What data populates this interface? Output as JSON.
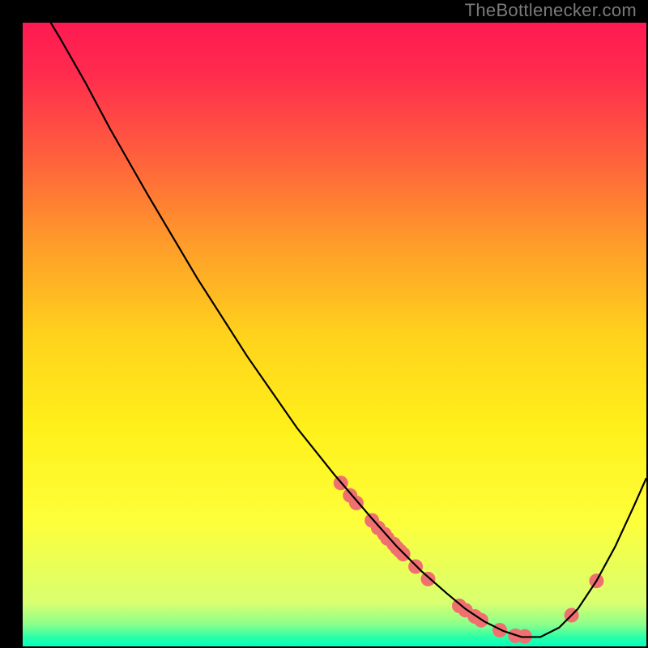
{
  "watermark": "TheBottlenecker.com",
  "chart_data": {
    "type": "line",
    "title": "",
    "xlabel": "",
    "ylabel": "",
    "xlim": [
      0,
      100
    ],
    "ylim": [
      0,
      100
    ],
    "grid": false,
    "legend": false,
    "background_gradient": {
      "stops": [
        {
          "offset": 0.0,
          "color": "#ff1a52"
        },
        {
          "offset": 0.08,
          "color": "#ff2b4e"
        },
        {
          "offset": 0.2,
          "color": "#ff5a3f"
        },
        {
          "offset": 0.35,
          "color": "#ff9a2a"
        },
        {
          "offset": 0.5,
          "color": "#ffd21c"
        },
        {
          "offset": 0.65,
          "color": "#fff01a"
        },
        {
          "offset": 0.8,
          "color": "#fdff3a"
        },
        {
          "offset": 0.93,
          "color": "#d9ff70"
        },
        {
          "offset": 0.965,
          "color": "#8bff8b"
        },
        {
          "offset": 0.985,
          "color": "#2bffa8"
        },
        {
          "offset": 1.0,
          "color": "#00ffc0"
        }
      ]
    },
    "series": [
      {
        "name": "bottleneck-curve",
        "color": "#000000",
        "width": 2.2,
        "x": [
          4.5,
          6.0,
          8.0,
          10.0,
          14.0,
          20.0,
          28.0,
          36.0,
          44.0,
          50.0,
          56.0,
          60.0,
          64.0,
          68.0,
          71.0,
          74.0,
          77.0,
          80.0,
          83.0,
          86.0,
          89.0,
          92.0,
          95.0,
          98.0,
          100.0
        ],
        "y": [
          100.0,
          97.5,
          94.0,
          90.5,
          83.0,
          72.5,
          59.0,
          46.5,
          35.0,
          27.5,
          20.5,
          16.0,
          12.0,
          8.5,
          6.0,
          4.0,
          2.5,
          1.5,
          1.5,
          3.0,
          6.0,
          10.5,
          16.0,
          22.5,
          27.0
        ]
      }
    ],
    "scatter": [
      {
        "name": "curve-dots",
        "color": "#f07070",
        "radius": 9,
        "x": [
          51.0,
          52.5,
          53.5,
          56.0,
          57.0,
          58.0,
          58.5,
          59.5,
          60.0,
          60.5,
          61.0,
          63.0,
          65.0,
          70.0,
          71.0,
          72.5,
          73.5,
          76.5,
          79.0,
          80.5,
          88.0,
          92.0
        ],
        "y": [
          26.2,
          24.2,
          23.0,
          20.2,
          19.0,
          18.0,
          17.3,
          16.4,
          15.8,
          15.3,
          14.8,
          12.8,
          10.8,
          6.5,
          5.8,
          4.8,
          4.2,
          2.6,
          1.7,
          1.6,
          5.0,
          10.5
        ]
      }
    ]
  }
}
